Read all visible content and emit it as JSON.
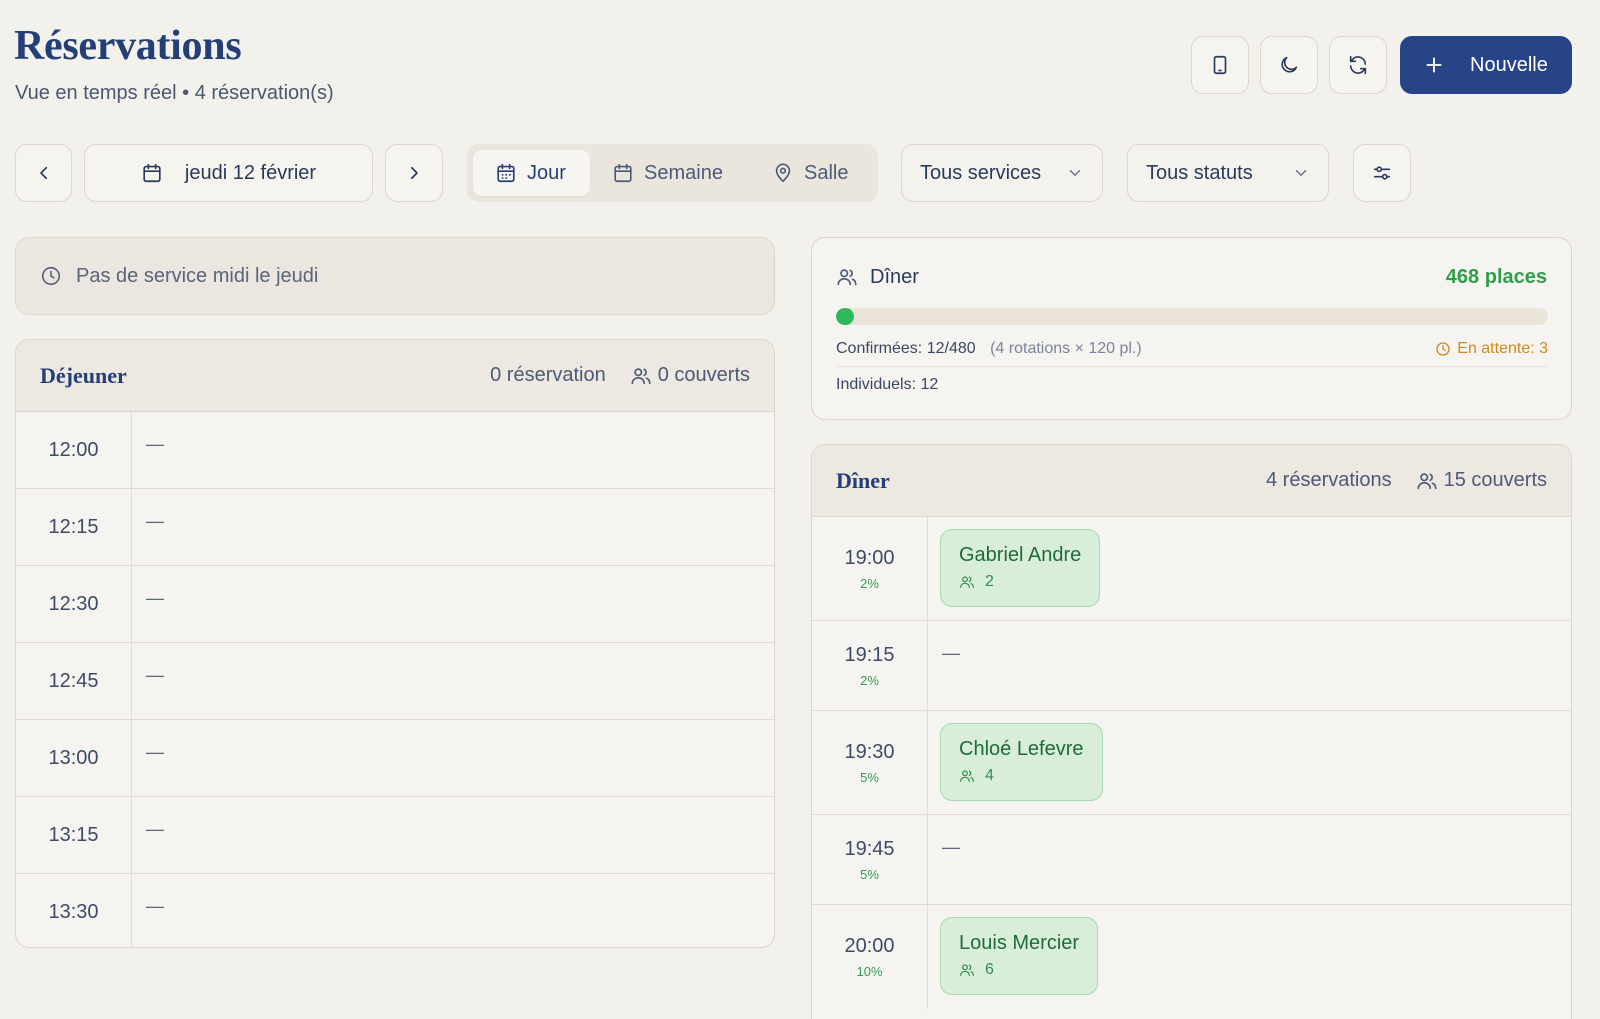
{
  "header": {
    "title": "Réservations",
    "subtitle": "Vue en temps réel • 4 réservation(s)",
    "actions": [
      "tablet-icon",
      "moon-icon",
      "refresh-icon"
    ],
    "new_label": "Nouvelle"
  },
  "toolbar": {
    "date_label": "jeudi 12 février",
    "views": [
      {
        "label": "Jour",
        "icon": "calendar-icon",
        "active": true
      },
      {
        "label": "Semaine",
        "icon": "calendar-icon",
        "active": false
      },
      {
        "label": "Salle",
        "icon": "map-pin-icon",
        "active": false
      }
    ],
    "service_filter": "Tous services",
    "status_filter": "Tous statuts"
  },
  "notice": "Pas de service midi le jeudi",
  "lunch": {
    "title": "Déjeuner",
    "count_label": "0 réservation",
    "covers_label": "0 couverts",
    "slots": [
      {
        "time": "12:00",
        "content": "—"
      },
      {
        "time": "12:15",
        "content": "—"
      },
      {
        "time": "12:30",
        "content": "—"
      },
      {
        "time": "12:45",
        "content": "—"
      },
      {
        "time": "13:00",
        "content": "—"
      },
      {
        "time": "13:15",
        "content": "—"
      },
      {
        "time": "13:30",
        "content": "—"
      }
    ]
  },
  "capacity": {
    "title": "Dîner",
    "places": "468 places",
    "fill_ratio": 0.025,
    "confirmed": "Confirmées: 12/480",
    "rotations": "(4 rotations × 120 pl.)",
    "waiting": "En attente: 3",
    "individuals": "Individuels: 12"
  },
  "dinner": {
    "title": "Dîner",
    "count_label": "4 réservations",
    "covers_label": "15 couverts",
    "slots": [
      {
        "time": "19:00",
        "pct": "2%",
        "reservation": {
          "name": "Gabriel Andre",
          "covers": "2"
        }
      },
      {
        "time": "19:15",
        "pct": "2%",
        "content": "—"
      },
      {
        "time": "19:30",
        "pct": "5%",
        "reservation": {
          "name": "Chloé Lefevre",
          "covers": "4"
        }
      },
      {
        "time": "19:45",
        "pct": "5%",
        "content": "—"
      },
      {
        "time": "20:00",
        "pct": "10%",
        "reservation": {
          "name": "Louis Mercier",
          "covers": "6"
        }
      }
    ]
  },
  "colors": {
    "accent": "#264486",
    "background": "#f3f1ec",
    "success": "#2eb85c",
    "warning": "#d08a1e"
  }
}
